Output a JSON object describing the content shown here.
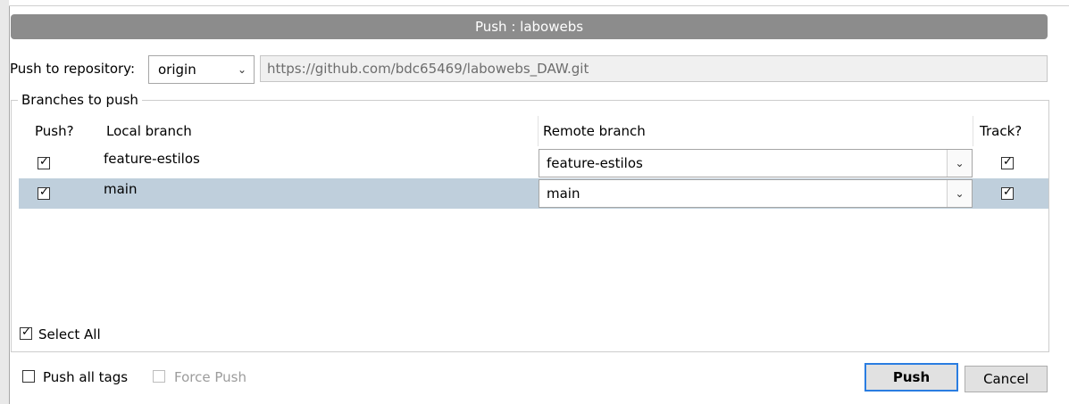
{
  "dialog": {
    "title": "Push : labowebs"
  },
  "repository": {
    "label": "Push to repository:",
    "selected": "origin",
    "url": "https://github.com/bdc65469/labowebs_DAW.git"
  },
  "branches": {
    "group_label": "Branches to push",
    "columns": {
      "push": "Push?",
      "local": "Local branch",
      "remote": "Remote branch",
      "track": "Track?"
    },
    "rows": [
      {
        "push": true,
        "local": "feature-estilos",
        "remote": "feature-estilos",
        "track": true,
        "selected": false
      },
      {
        "push": true,
        "local": "main",
        "remote": "main",
        "track": true,
        "selected": true
      }
    ],
    "select_all_label": "Select All",
    "select_all": true
  },
  "options": {
    "push_all_tags_label": "Push all tags",
    "push_all_tags": false,
    "force_push_label": "Force Push",
    "force_push": false
  },
  "buttons": {
    "push": "Push",
    "cancel": "Cancel"
  },
  "icons": {
    "chevron": "chevron-down-icon",
    "check": "checkmark-icon"
  }
}
